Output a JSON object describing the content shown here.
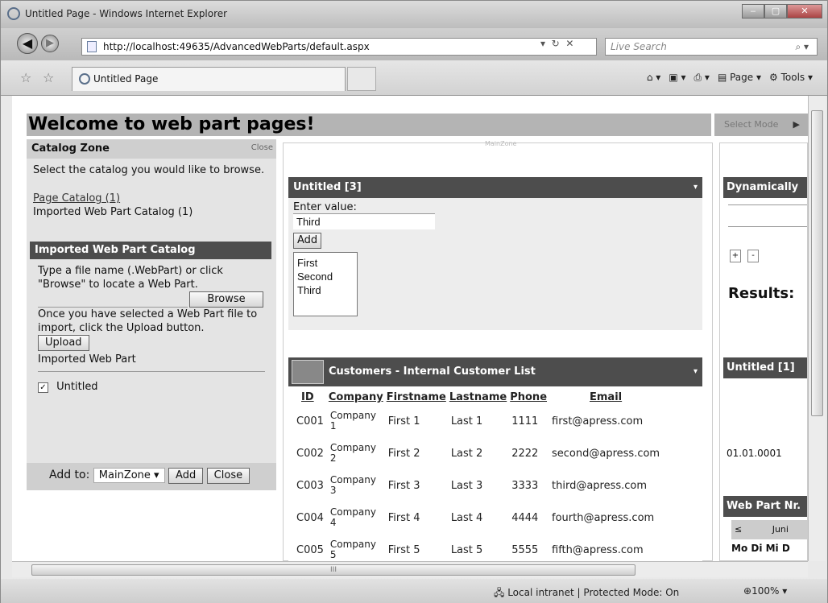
{
  "window": {
    "title": "Untitled Page - Windows Internet Explorer"
  },
  "address": {
    "url": "http://localhost:49635/AdvancedWebParts/default.aspx",
    "search_placeholder": "Live Search"
  },
  "tab": {
    "label": "Untitled Page"
  },
  "toolbar": {
    "page_label": "Page",
    "tools_label": "Tools"
  },
  "page": {
    "heading": "Welcome to web part pages!",
    "select_mode": "Select Mode"
  },
  "catalog_zone": {
    "title": "Catalog Zone",
    "close": "Close",
    "instruction": "Select the catalog you would like to browse.",
    "page_catalog": "Page Catalog (1)",
    "imported_catalog": "Imported Web Part Catalog (1)",
    "imported_header": "Imported Web Part Catalog",
    "file_instruction": "Type a file name (.WebPart) or click \"Browse\" to locate a Web Part.",
    "browse": "Browse",
    "upload_instruction": "Once you have selected a Web Part file to import, click the Upload button.",
    "upload": "Upload",
    "imported_part": "Imported Web Part",
    "item_untitled": "Untitled",
    "add_to_label": "Add to:",
    "zone_select": "MainZone",
    "add": "Add",
    "close_btn": "Close"
  },
  "untitled3": {
    "title": "Untitled [3]",
    "enter_label": "Enter value:",
    "input_value": "Third",
    "add": "Add",
    "items": [
      "First",
      "Second",
      "Third"
    ]
  },
  "customers": {
    "title": "Customers - Internal Customer List",
    "columns": [
      "ID",
      "Company",
      "Firstname",
      "Lastname",
      "Phone",
      "Email"
    ],
    "rows": [
      {
        "id": "C001",
        "company": "Company",
        "company_n": "1",
        "first": "First 1",
        "last": "Last 1",
        "phone": "1111",
        "email": "first@apress.com"
      },
      {
        "id": "C002",
        "company": "Company",
        "company_n": "2",
        "first": "First 2",
        "last": "Last 2",
        "phone": "2222",
        "email": "second@apress.com"
      },
      {
        "id": "C003",
        "company": "Company",
        "company_n": "3",
        "first": "First 3",
        "last": "Last 3",
        "phone": "3333",
        "email": "third@apress.com"
      },
      {
        "id": "C004",
        "company": "Company",
        "company_n": "4",
        "first": "First 4",
        "last": "Last 4",
        "phone": "4444",
        "email": "fourth@apress.com"
      },
      {
        "id": "C005",
        "company": "Company",
        "company_n": "5",
        "first": "First 5",
        "last": "Last 5",
        "phone": "5555",
        "email": "fifth@apress.com"
      }
    ]
  },
  "right_zone": {
    "dynamic_title": "Dynamically",
    "results": "Results:",
    "untitled1": "Untitled [1]",
    "date": "01.01.0001",
    "webpart_nr": "Web Part Nr.",
    "cal_prev": "≤",
    "cal_month": "Juni",
    "cal_days": "Mo Di Mi D"
  },
  "status": {
    "zone": "Local intranet | Protected Mode: On",
    "zoom": "100%"
  }
}
